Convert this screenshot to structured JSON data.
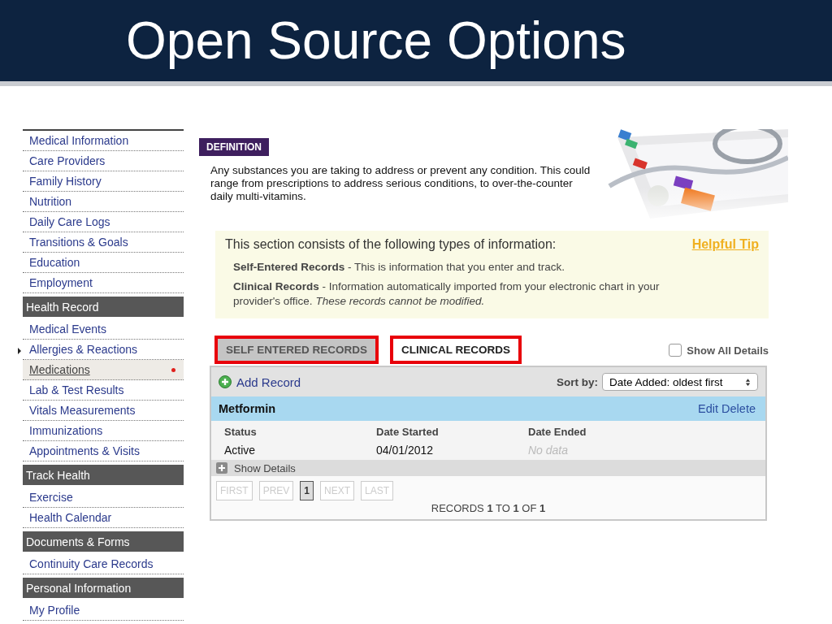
{
  "slide": {
    "title": "Open Source Options"
  },
  "sidebar": {
    "sections": [
      {
        "items": [
          {
            "label": "Medical Information",
            "selected": false
          },
          {
            "label": "Care Providers",
            "selected": false
          },
          {
            "label": "Family History",
            "selected": false
          },
          {
            "label": "Nutrition",
            "selected": false
          },
          {
            "label": "Daily Care Logs",
            "selected": false
          },
          {
            "label": "Transitions & Goals",
            "selected": false
          },
          {
            "label": "Education",
            "selected": false
          },
          {
            "label": "Employment",
            "selected": false
          }
        ]
      },
      {
        "header": "Health Record",
        "items": [
          {
            "label": "Medical Events",
            "selected": false
          },
          {
            "label": "Allergies & Reactions",
            "selected": false
          },
          {
            "label": "Medications",
            "selected": true
          },
          {
            "label": "Lab & Test Results",
            "selected": false
          },
          {
            "label": "Vitals Measurements",
            "selected": false
          },
          {
            "label": "Immunizations",
            "selected": false
          },
          {
            "label": "Appointments & Visits",
            "selected": false
          }
        ]
      },
      {
        "header": "Track Health",
        "items": [
          {
            "label": "Exercise",
            "selected": false
          },
          {
            "label": "Health Calendar",
            "selected": false
          }
        ]
      },
      {
        "header": "Documents & Forms",
        "items": [
          {
            "label": "Continuity Care Records",
            "selected": false
          }
        ]
      },
      {
        "header": "Personal Information",
        "items": [
          {
            "label": "My Profile",
            "selected": false
          }
        ]
      }
    ]
  },
  "definition": {
    "label": "DEFINITION",
    "text": "Any substances you are taking to address or prevent any condition. This could range from prescriptions to address serious conditions, to over-the-counter daily multi-vitamins."
  },
  "info_box": {
    "heading": "This section consists of the following types of information:",
    "tip_link": "Helpful Tip",
    "lines": [
      "**Self-Entered Records** - This is information that you enter and track.",
      "**Clinical Records** - Information automatically imported from your electronic chart in your provider's office. *These records cannot be modified.*"
    ]
  },
  "tabs": [
    {
      "label": "SELF ENTERED RECORDS",
      "selected": true,
      "highlighted": true
    },
    {
      "label": "CLINICAL RECORDS",
      "selected": false,
      "highlighted": true
    }
  ],
  "show_all_details": {
    "label": "Show All Details",
    "checked": false
  },
  "toolbar": {
    "add_record": "Add Record",
    "sort_label": "Sort by:",
    "sort_value": "Date Added: oldest first"
  },
  "records": [
    {
      "name": "Metformin",
      "actions": [
        "Edit",
        "Delete"
      ],
      "fields": [
        {
          "label": "Status",
          "value": "Active",
          "empty": false
        },
        {
          "label": "Date Started",
          "value": "04/01/2012",
          "empty": false
        },
        {
          "label": "Date Ended",
          "value": "No data",
          "empty": true
        }
      ],
      "details_label": "Show Details"
    }
  ],
  "pager": {
    "buttons": [
      {
        "label": "FIRST",
        "disabled": true,
        "selected": false
      },
      {
        "label": "PREV",
        "disabled": true,
        "selected": false
      },
      {
        "label": "1",
        "disabled": false,
        "selected": true
      },
      {
        "label": "NEXT",
        "disabled": true,
        "selected": false
      },
      {
        "label": "LAST",
        "disabled": true,
        "selected": false
      }
    ],
    "summary": "RECORDS **1** TO **1** OF **1**"
  }
}
